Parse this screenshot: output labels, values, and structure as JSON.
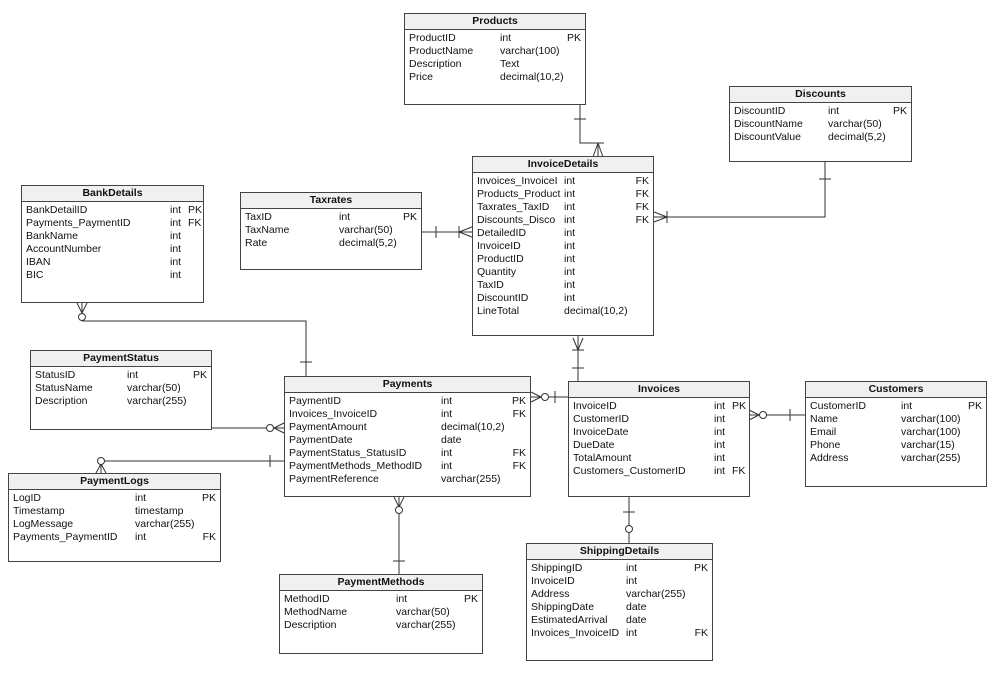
{
  "diagram": {
    "type": "entity-relationship",
    "entities": [
      {
        "id": "products",
        "title": "Products",
        "columns": [
          {
            "name": "ProductID",
            "type": "int",
            "key": "PK"
          },
          {
            "name": "ProductName",
            "type": "varchar(100)",
            "key": ""
          },
          {
            "name": "Description",
            "type": "Text",
            "key": ""
          },
          {
            "name": "Price",
            "type": "decimal(10,2)",
            "key": ""
          }
        ]
      },
      {
        "id": "discounts",
        "title": "Discounts",
        "columns": [
          {
            "name": "DiscountID",
            "type": "int",
            "key": "PK"
          },
          {
            "name": "DiscountName",
            "type": "varchar(50)",
            "key": ""
          },
          {
            "name": "DiscountValue",
            "type": "decimal(5,2)",
            "key": ""
          }
        ]
      },
      {
        "id": "invoicedetails",
        "title": "InvoiceDetails",
        "columns": [
          {
            "name": "Invoices_InvoiceI",
            "type": "int",
            "key": "FK"
          },
          {
            "name": "Products_Product",
            "type": "int",
            "key": "FK"
          },
          {
            "name": "Taxrates_TaxID",
            "type": "int",
            "key": "FK"
          },
          {
            "name": "Discounts_Disco",
            "type": "int",
            "key": "FK"
          },
          {
            "name": "DetailedID",
            "type": "int",
            "key": ""
          },
          {
            "name": "InvoiceID",
            "type": "int",
            "key": ""
          },
          {
            "name": "ProductID",
            "type": "int",
            "key": ""
          },
          {
            "name": "Quantity",
            "type": "int",
            "key": ""
          },
          {
            "name": "TaxID",
            "type": "int",
            "key": ""
          },
          {
            "name": "DiscountID",
            "type": "int",
            "key": ""
          },
          {
            "name": "LineTotal",
            "type": "decimal(10,2)",
            "key": ""
          }
        ]
      },
      {
        "id": "bankdetails",
        "title": "BankDetails",
        "columns": [
          {
            "name": "BankDetailID",
            "type": "int",
            "key": "PK"
          },
          {
            "name": "Payments_PaymentID",
            "type": "int",
            "key": "FK"
          },
          {
            "name": "BankName",
            "type": "int",
            "key": ""
          },
          {
            "name": "AccountNumber",
            "type": "int",
            "key": ""
          },
          {
            "name": "IBAN",
            "type": "int",
            "key": ""
          },
          {
            "name": "BIC",
            "type": "int",
            "key": ""
          }
        ]
      },
      {
        "id": "taxrates",
        "title": "Taxrates",
        "columns": [
          {
            "name": "TaxID",
            "type": "int",
            "key": "PK"
          },
          {
            "name": "TaxName",
            "type": "varchar(50)",
            "key": ""
          },
          {
            "name": "Rate",
            "type": "decimal(5,2)",
            "key": ""
          }
        ]
      },
      {
        "id": "paymentstatus",
        "title": "PaymentStatus",
        "columns": [
          {
            "name": "StatusID",
            "type": "int",
            "key": "PK"
          },
          {
            "name": "StatusName",
            "type": "varchar(50)",
            "key": ""
          },
          {
            "name": "Description",
            "type": "varchar(255)",
            "key": ""
          }
        ]
      },
      {
        "id": "payments",
        "title": "Payments",
        "columns": [
          {
            "name": "PaymentID",
            "type": "int",
            "key": "PK"
          },
          {
            "name": "Invoices_InvoiceID",
            "type": "int",
            "key": "FK"
          },
          {
            "name": "PaymentAmount",
            "type": "decimal(10,2)",
            "key": ""
          },
          {
            "name": "PaymentDate",
            "type": "date",
            "key": ""
          },
          {
            "name": "PaymentStatus_StatusID",
            "type": "int",
            "key": "FK"
          },
          {
            "name": "PaymentMethods_MethodID",
            "type": "int",
            "key": "FK"
          },
          {
            "name": "PaymentReference",
            "type": "varchar(255)",
            "key": ""
          }
        ]
      },
      {
        "id": "invoices",
        "title": "Invoices",
        "columns": [
          {
            "name": "InvoiceID",
            "type": "int",
            "key": "PK"
          },
          {
            "name": "CustomerID",
            "type": "int",
            "key": ""
          },
          {
            "name": "InvoiceDate",
            "type": "int",
            "key": ""
          },
          {
            "name": "DueDate",
            "type": "int",
            "key": ""
          },
          {
            "name": "TotalAmount",
            "type": "int",
            "key": ""
          },
          {
            "name": "Customers_CustomerID",
            "type": "int",
            "key": "FK"
          }
        ]
      },
      {
        "id": "customers",
        "title": "Customers",
        "columns": [
          {
            "name": "CustomerID",
            "type": "int",
            "key": "PK"
          },
          {
            "name": "Name",
            "type": "varchar(100)",
            "key": ""
          },
          {
            "name": "Email",
            "type": "varchar(100)",
            "key": ""
          },
          {
            "name": "Phone",
            "type": "varchar(15)",
            "key": ""
          },
          {
            "name": "Address",
            "type": "varchar(255)",
            "key": ""
          }
        ]
      },
      {
        "id": "paymentlogs",
        "title": "PaymentLogs",
        "columns": [
          {
            "name": "LogID",
            "type": "int",
            "key": "PK"
          },
          {
            "name": "Timestamp",
            "type": "timestamp",
            "key": ""
          },
          {
            "name": "LogMessage",
            "type": "varchar(255)",
            "key": ""
          },
          {
            "name": "Payments_PaymentID",
            "type": "int",
            "key": "FK"
          }
        ]
      },
      {
        "id": "paymentmethods",
        "title": "PaymentMethods",
        "columns": [
          {
            "name": "MethodID",
            "type": "int",
            "key": "PK"
          },
          {
            "name": "MethodName",
            "type": "varchar(50)",
            "key": ""
          },
          {
            "name": "Description",
            "type": "varchar(255)",
            "key": ""
          }
        ]
      },
      {
        "id": "shippingdetails",
        "title": "ShippingDetails",
        "columns": [
          {
            "name": "ShippingID",
            "type": "int",
            "key": "PK"
          },
          {
            "name": "InvoiceID",
            "type": "int",
            "key": ""
          },
          {
            "name": "Address",
            "type": "varchar(255)",
            "key": ""
          },
          {
            "name": "ShippingDate",
            "type": "date",
            "key": ""
          },
          {
            "name": "EstimatedArrival",
            "type": "date",
            "key": ""
          },
          {
            "name": "Invoices_InvoiceID",
            "type": "int",
            "key": "FK"
          }
        ]
      }
    ],
    "relationships": [
      {
        "from": "products",
        "to": "invoicedetails",
        "from_card": "one",
        "to_card": "one-or-many"
      },
      {
        "from": "discounts",
        "to": "invoicedetails",
        "from_card": "one",
        "to_card": "one-or-many"
      },
      {
        "from": "taxrates",
        "to": "invoicedetails",
        "from_card": "one",
        "to_card": "one-or-many"
      },
      {
        "from": "invoices",
        "to": "invoicedetails",
        "from_card": "one",
        "to_card": "one-or-many"
      },
      {
        "from": "payments",
        "to": "bankdetails",
        "from_card": "one",
        "to_card": "zero-or-many"
      },
      {
        "from": "paymentstatus",
        "to": "payments",
        "from_card": "one",
        "to_card": "zero-or-many"
      },
      {
        "from": "invoices",
        "to": "payments",
        "from_card": "one",
        "to_card": "zero-or-many"
      },
      {
        "from": "customers",
        "to": "invoices",
        "from_card": "one",
        "to_card": "zero-or-many"
      },
      {
        "from": "payments",
        "to": "paymentlogs",
        "from_card": "one",
        "to_card": "zero-or-many"
      },
      {
        "from": "paymentmethods",
        "to": "payments",
        "from_card": "one",
        "to_card": "zero-or-many"
      },
      {
        "from": "invoices",
        "to": "shippingdetails",
        "from_card": "one",
        "to_card": "zero-or-one"
      }
    ]
  }
}
